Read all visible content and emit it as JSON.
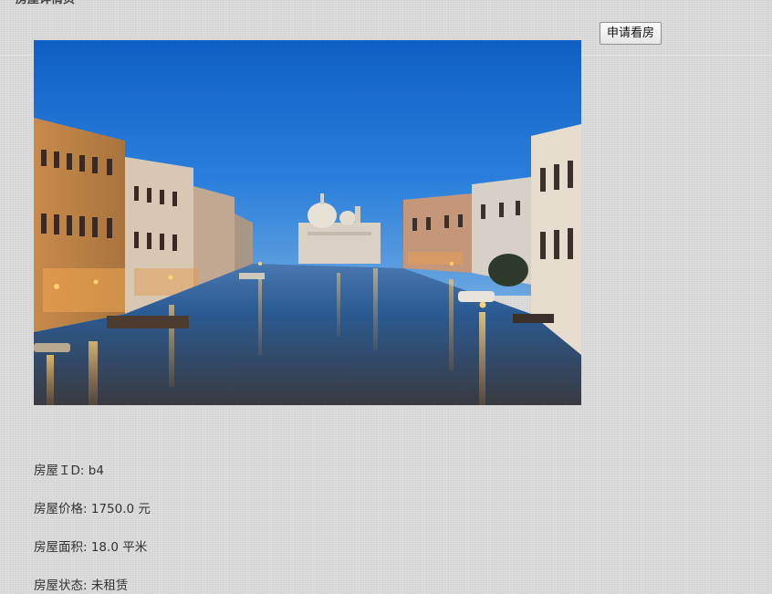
{
  "page": {
    "title": "房屋详情页"
  },
  "actions": {
    "apply_button_label": "申请看房"
  },
  "photo": {
    "subject": "canal-city-at-dusk",
    "sky_color": "#1f6fd0",
    "water_color": "#1c3f6e",
    "light_color": "#ffb040"
  },
  "house": {
    "id_label": "房屋ＩD: ",
    "id_value": "b4",
    "price_label": "房屋价格: ",
    "price_value": "1750.0",
    "price_unit": " 元",
    "area_label": "房屋面积: ",
    "area_value": "18.0",
    "area_unit": " 平米",
    "status_label": "房屋状态: ",
    "status_value": "未租赁"
  }
}
